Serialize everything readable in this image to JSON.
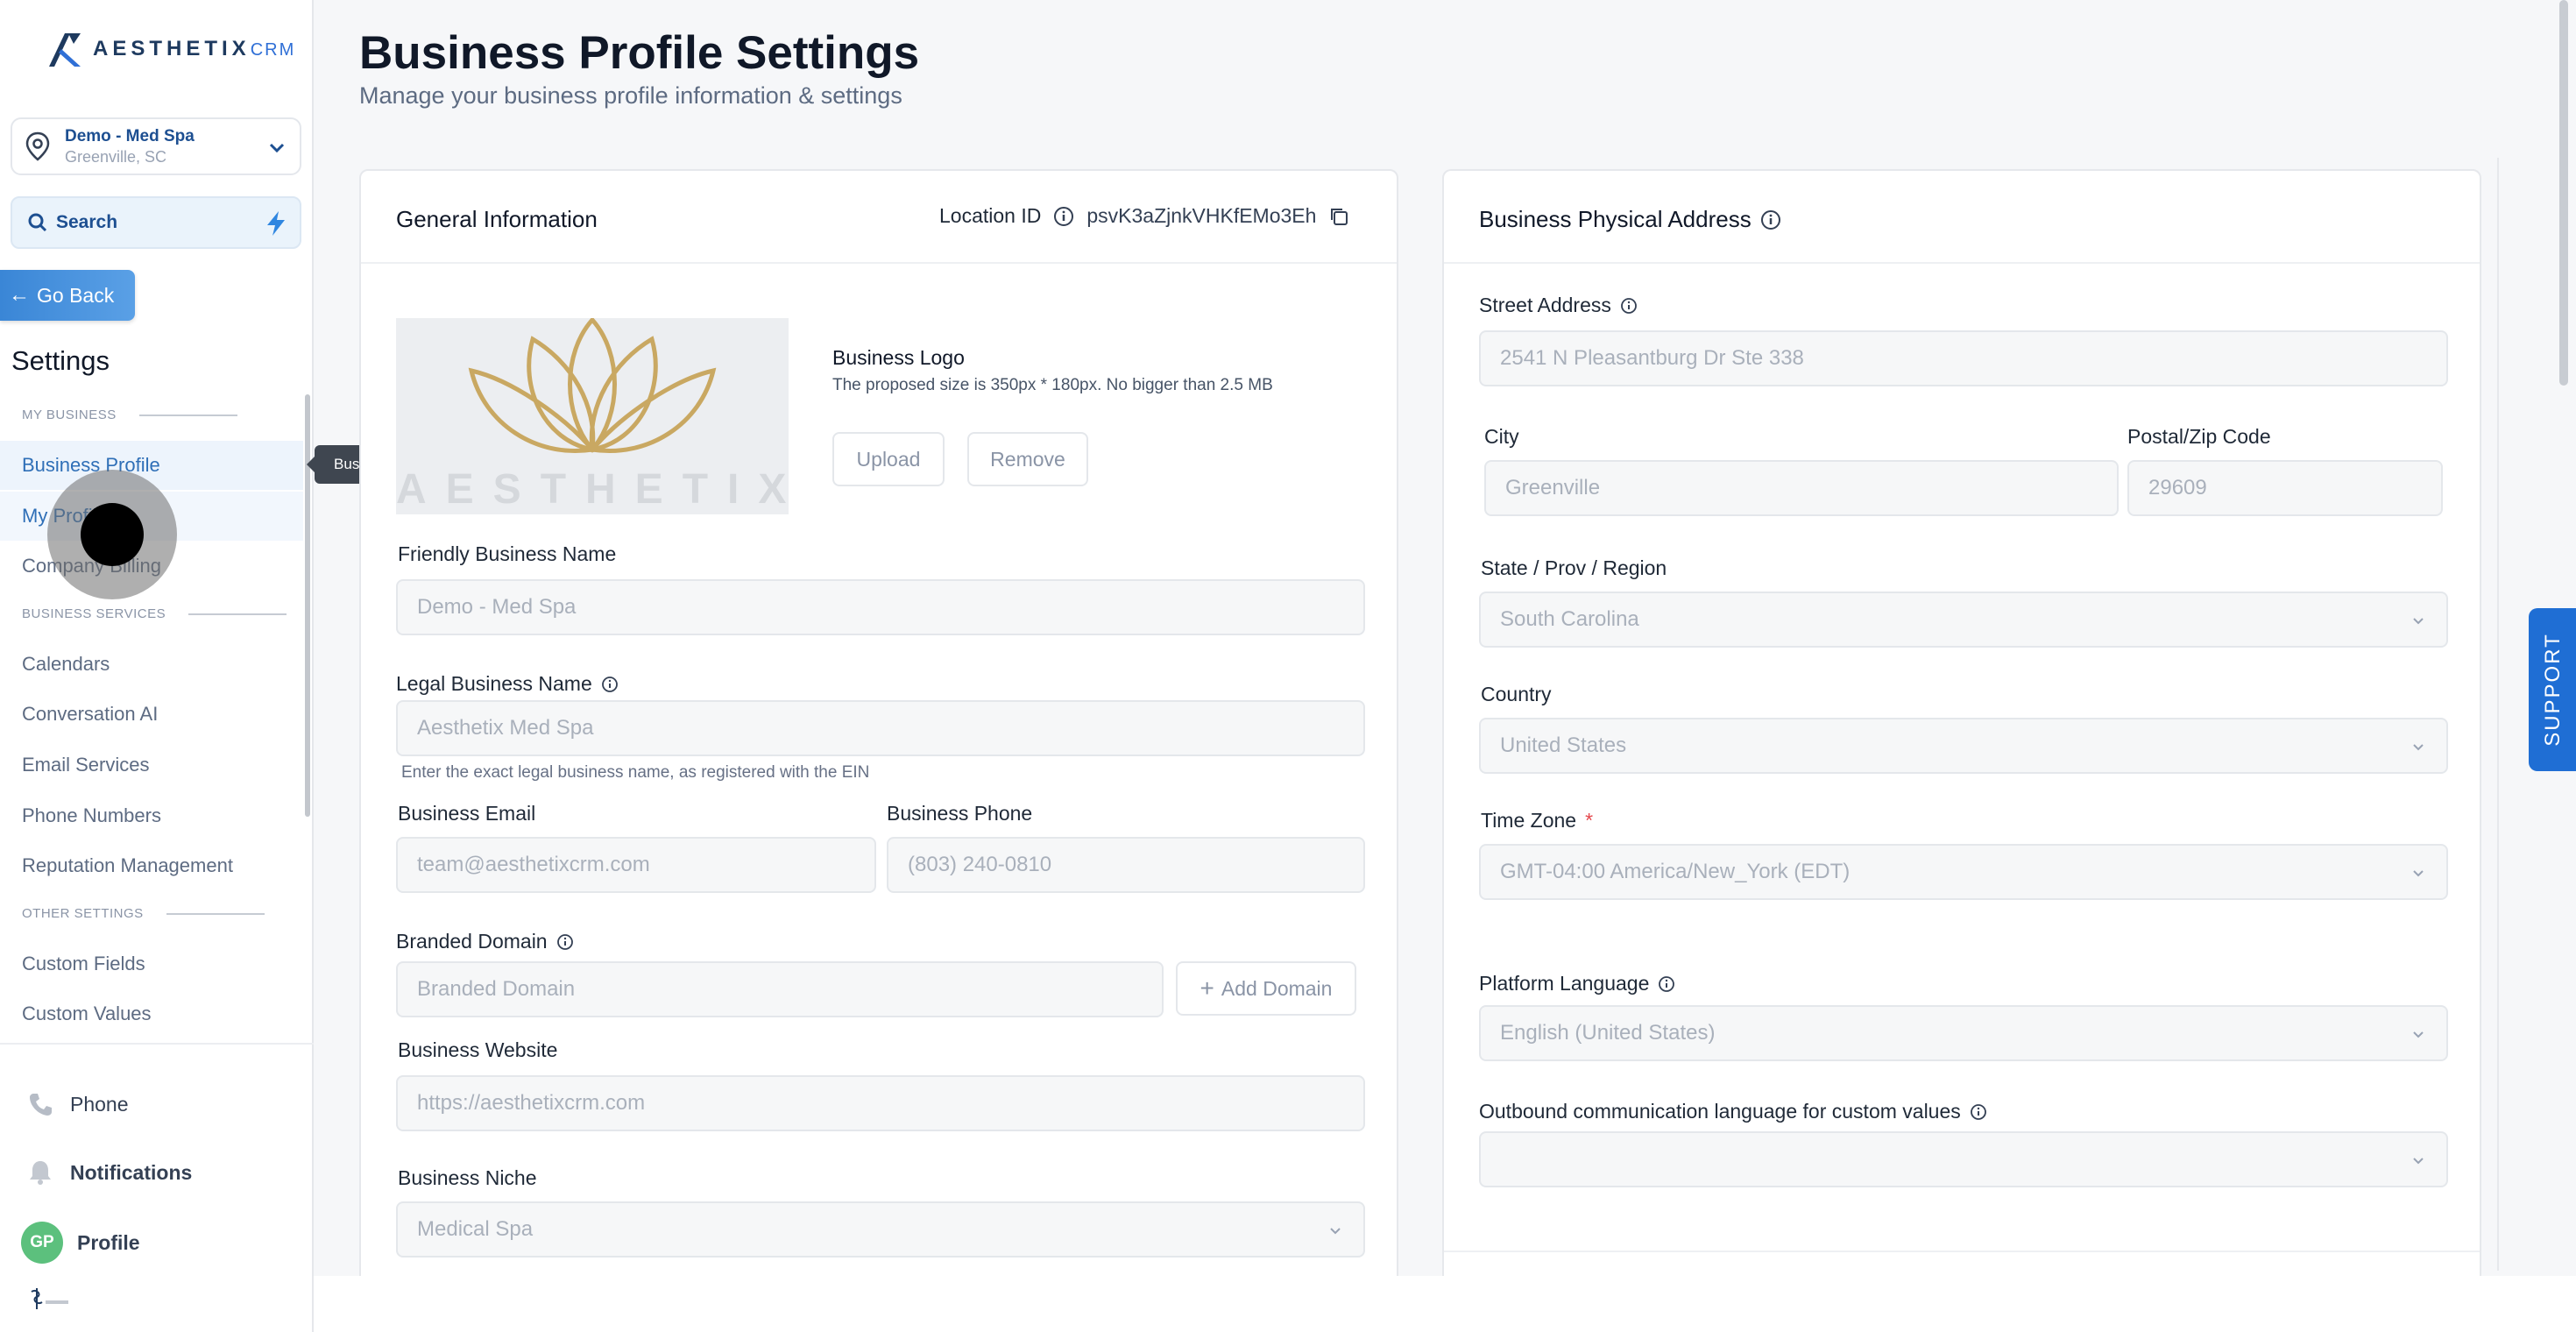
{
  "brand": {
    "logo_text_a": "AESTHETIX",
    "logo_text_b": "CRM",
    "accent": "#2f6fd6"
  },
  "location": {
    "name": "Demo - Med Spa",
    "city": "Greenville, SC"
  },
  "search": {
    "label": "Search"
  },
  "go_back": "Go Back",
  "settings_heading": "Settings",
  "sidebar": {
    "sections": [
      {
        "label": "MY BUSINESS"
      },
      {
        "label": "BUSINESS SERVICES"
      },
      {
        "label": "OTHER SETTINGS"
      }
    ],
    "items": [
      {
        "label": "Business Profile"
      },
      {
        "label": "My Profile"
      },
      {
        "label": "Company Billing"
      },
      {
        "label": "Calendars"
      },
      {
        "label": "Conversation AI"
      },
      {
        "label": "Email Services"
      },
      {
        "label": "Phone Numbers"
      },
      {
        "label": "Reputation Management"
      },
      {
        "label": "Custom Fields"
      },
      {
        "label": "Custom Values"
      }
    ],
    "tooltip": "Business Profile",
    "bottom": {
      "phone": "Phone",
      "notifications": "Notifications",
      "profile": "Profile",
      "avatar_initials": "GP"
    }
  },
  "page": {
    "title": "Business Profile Settings",
    "subtitle": "Manage your business profile information & settings"
  },
  "general": {
    "title": "General Information",
    "location_id_label": "Location ID",
    "location_id": "psvK3aZjnkVHKfEMo3Eh",
    "logo_watermark": "AESTHETIX",
    "logo_title": "Business Logo",
    "logo_hint": "The proposed size is 350px * 180px. No bigger than 2.5 MB",
    "upload": "Upload",
    "remove": "Remove",
    "friendly_name_label": "Friendly Business Name",
    "friendly_name": "Demo - Med Spa",
    "legal_name_label": "Legal Business Name",
    "legal_name": "Aesthetix Med Spa",
    "legal_name_help": "Enter the exact legal business name, as registered with the EIN",
    "email_label": "Business Email",
    "email": "team@aesthetixcrm.com",
    "phone_label": "Business Phone",
    "phone": "(803) 240-0810",
    "domain_label": "Branded Domain",
    "domain_placeholder": "Branded Domain",
    "add_domain": "Add Domain",
    "website_label": "Business Website",
    "website": "https://aesthetixcrm.com",
    "niche_label": "Business Niche",
    "niche": "Medical Spa"
  },
  "address": {
    "title": "Business Physical Address",
    "street_label": "Street Address",
    "street": "2541 N Pleasantburg Dr Ste 338",
    "city_label": "City",
    "city": "Greenville",
    "zip_label": "Postal/Zip Code",
    "zip": "29609",
    "state_label": "State / Prov / Region",
    "state": "South Carolina",
    "country_label": "Country",
    "country": "United States",
    "timezone_label": "Time Zone",
    "timezone_required": "*",
    "timezone": "GMT-04:00 America/New_York (EDT)",
    "language_label": "Platform Language",
    "language": "English (United States)",
    "outbound_label": "Outbound communication language for custom values",
    "outbound": ""
  },
  "support": "SUPPORT"
}
